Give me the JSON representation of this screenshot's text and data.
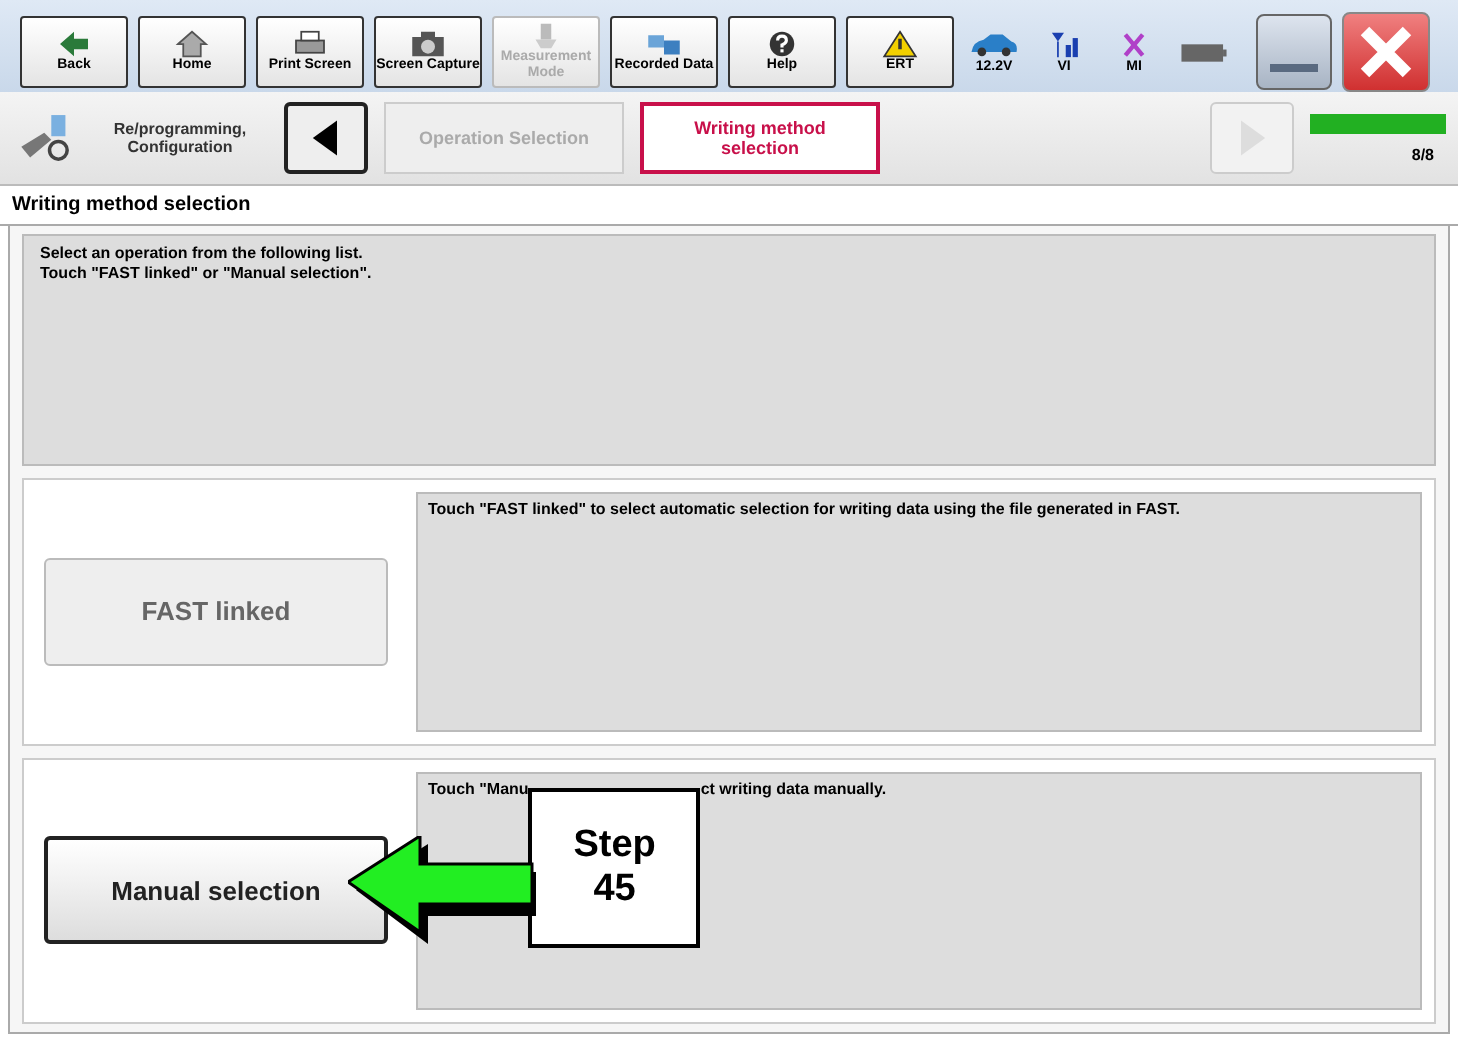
{
  "toolbar": {
    "buttons": [
      {
        "kind": "back",
        "label": "Back",
        "disabled": false
      },
      {
        "kind": "home",
        "label": "Home",
        "disabled": false
      },
      {
        "kind": "print",
        "label": "Print Screen",
        "disabled": false
      },
      {
        "kind": "camera",
        "label": "Screen Capture",
        "disabled": false
      },
      {
        "kind": "measure",
        "label": "Measurement Mode",
        "disabled": true
      },
      {
        "kind": "data",
        "label": "Recorded Data",
        "disabled": false
      },
      {
        "kind": "help",
        "label": "Help",
        "disabled": false
      },
      {
        "kind": "ert",
        "label": "ERT",
        "disabled": false
      }
    ],
    "indicators": [
      {
        "kind": "car",
        "label": "12.2V"
      },
      {
        "kind": "signal",
        "label": "VI"
      },
      {
        "kind": "cross",
        "label": "MI"
      },
      {
        "kind": "battery"
      }
    ]
  },
  "nav": {
    "section": "Re/programming, Configuration",
    "steps": [
      {
        "label": "Operation Selection",
        "selected": false
      },
      {
        "label": "Writing method selection",
        "selected": true
      }
    ],
    "progress": {
      "level": 1,
      "text": "8/8"
    }
  },
  "page_title": "Writing method selection",
  "instructions": [
    "Select an operation from the following list.",
    "Touch \"FAST linked\" or \"Manual selection\"."
  ],
  "options": [
    {
      "button": "FAST linked",
      "disabled": true,
      "description": [
        "Touch \"FAST linked\" to select automatic selection for writing data using the file generated in FAST."
      ]
    },
    {
      "button": "Manual selection",
      "disabled": false,
      "description": [
        "Touch \"Manu",
        "ct writing data manually."
      ],
      "callout": "Step 45"
    }
  ]
}
